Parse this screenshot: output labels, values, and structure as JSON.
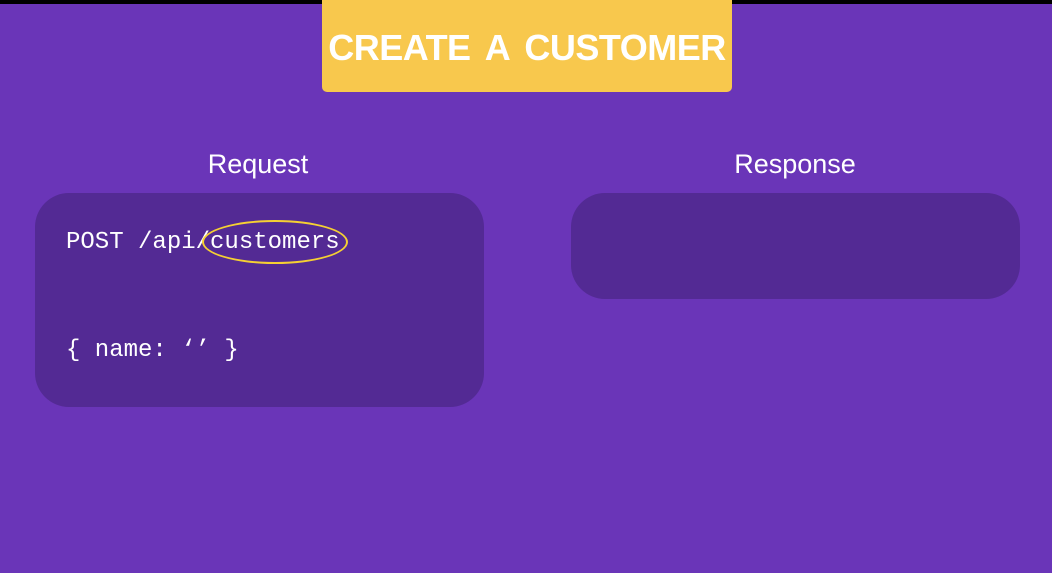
{
  "title": "CREATE  A CUSTOMER",
  "request": {
    "label": "Request",
    "method_path": "POST /api/",
    "resource": "customers",
    "body": "{ name: ‘’ }"
  },
  "response": {
    "label": "Response"
  },
  "colors": {
    "background": "#6a35b8",
    "panel": "#532a94",
    "banner": "#f8c84d",
    "highlight": "#f5d033"
  }
}
